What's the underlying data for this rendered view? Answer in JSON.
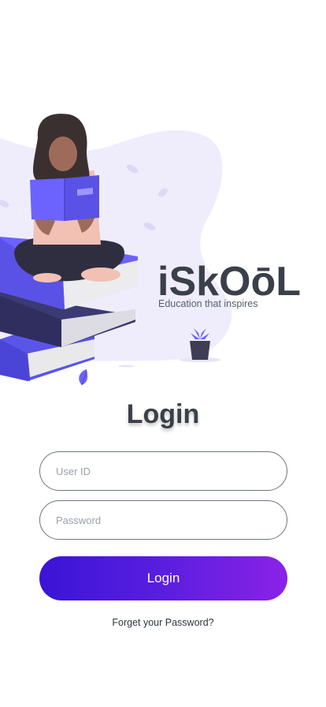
{
  "brand": {
    "name": "iSkOōL",
    "tagline": "Education that inspires",
    "colors": {
      "dark": "#3a3f4a",
      "accent": "#6c63ff"
    }
  },
  "illustration": {
    "subject": "woman-reading-on-book-stack",
    "icons": [
      "leaf-icon",
      "plant-pot-icon"
    ]
  },
  "login": {
    "title": "Login",
    "user_id_placeholder": "User ID",
    "password_placeholder": "Password",
    "button_label": "Login",
    "forgot_label": "Forget your Password?",
    "button_gradient": [
      "#3a14d6",
      "#8a22e6"
    ]
  }
}
